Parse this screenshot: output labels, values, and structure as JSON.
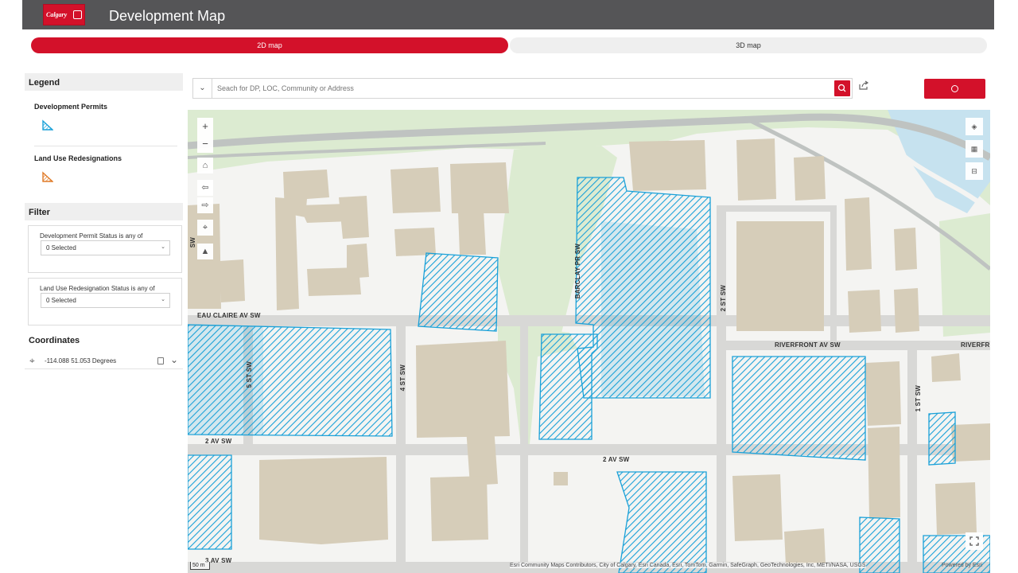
{
  "header": {
    "logo_text": "Calgary",
    "title": "Development Map"
  },
  "tabs": [
    {
      "label": "2D map",
      "active": true
    },
    {
      "label": "3D map",
      "active": false
    }
  ],
  "legend": {
    "title": "Legend",
    "items": [
      {
        "label": "Development Permits",
        "symbol": "dp-hatch-icon",
        "color": "#1ba1d8"
      },
      {
        "label": "Land Use Redesignations",
        "symbol": "lur-hatch-icon",
        "color": "#e07b28"
      }
    ]
  },
  "filter": {
    "title": "Filter",
    "fields": [
      {
        "label": "Development Permit Status is any of",
        "value": "0 Selected"
      },
      {
        "label": "Land Use Redesignation Status is any of",
        "value": "0 Selected"
      }
    ]
  },
  "coordinates": {
    "title": "Coordinates",
    "value": "-114.088 51.053 Degrees"
  },
  "search": {
    "placeholder": "Seach for DP, LOC, Community or Address"
  },
  "map": {
    "zoom_in": "+",
    "zoom_out": "−",
    "streets": {
      "eau_claire": "EAU CLAIRE AV SW",
      "barclay": "BARCLAY PR SW",
      "second_st": "2 ST SW",
      "riverfront": "RIVERFRONT AV SW",
      "riverfront_right": "RIVERFR",
      "fifth_st": "5 ST SW",
      "fourth_st": "4 ST SW",
      "second_av_left": "2 AV SW",
      "second_av_mid": "2 AV SW",
      "first_st": "1 ST SW",
      "third_av": "3 AV SW",
      "left_edge": "SW"
    },
    "scale": "50 m",
    "attribution": "Esri Community Maps Contributors, City of Calgary, Esri Canada, Esri, TomTom, Garmin, SafeGraph, GeoTechnologies, Inc, METI/NASA, USGS",
    "powered_by": "Powered by Esri"
  },
  "colors": {
    "brand": "#d3112a",
    "header": "#555557",
    "dp_hatch": "#1ba1d8",
    "building": "#d6cdb9",
    "park": "#d9ebd0",
    "water": "#c6e2ef"
  }
}
